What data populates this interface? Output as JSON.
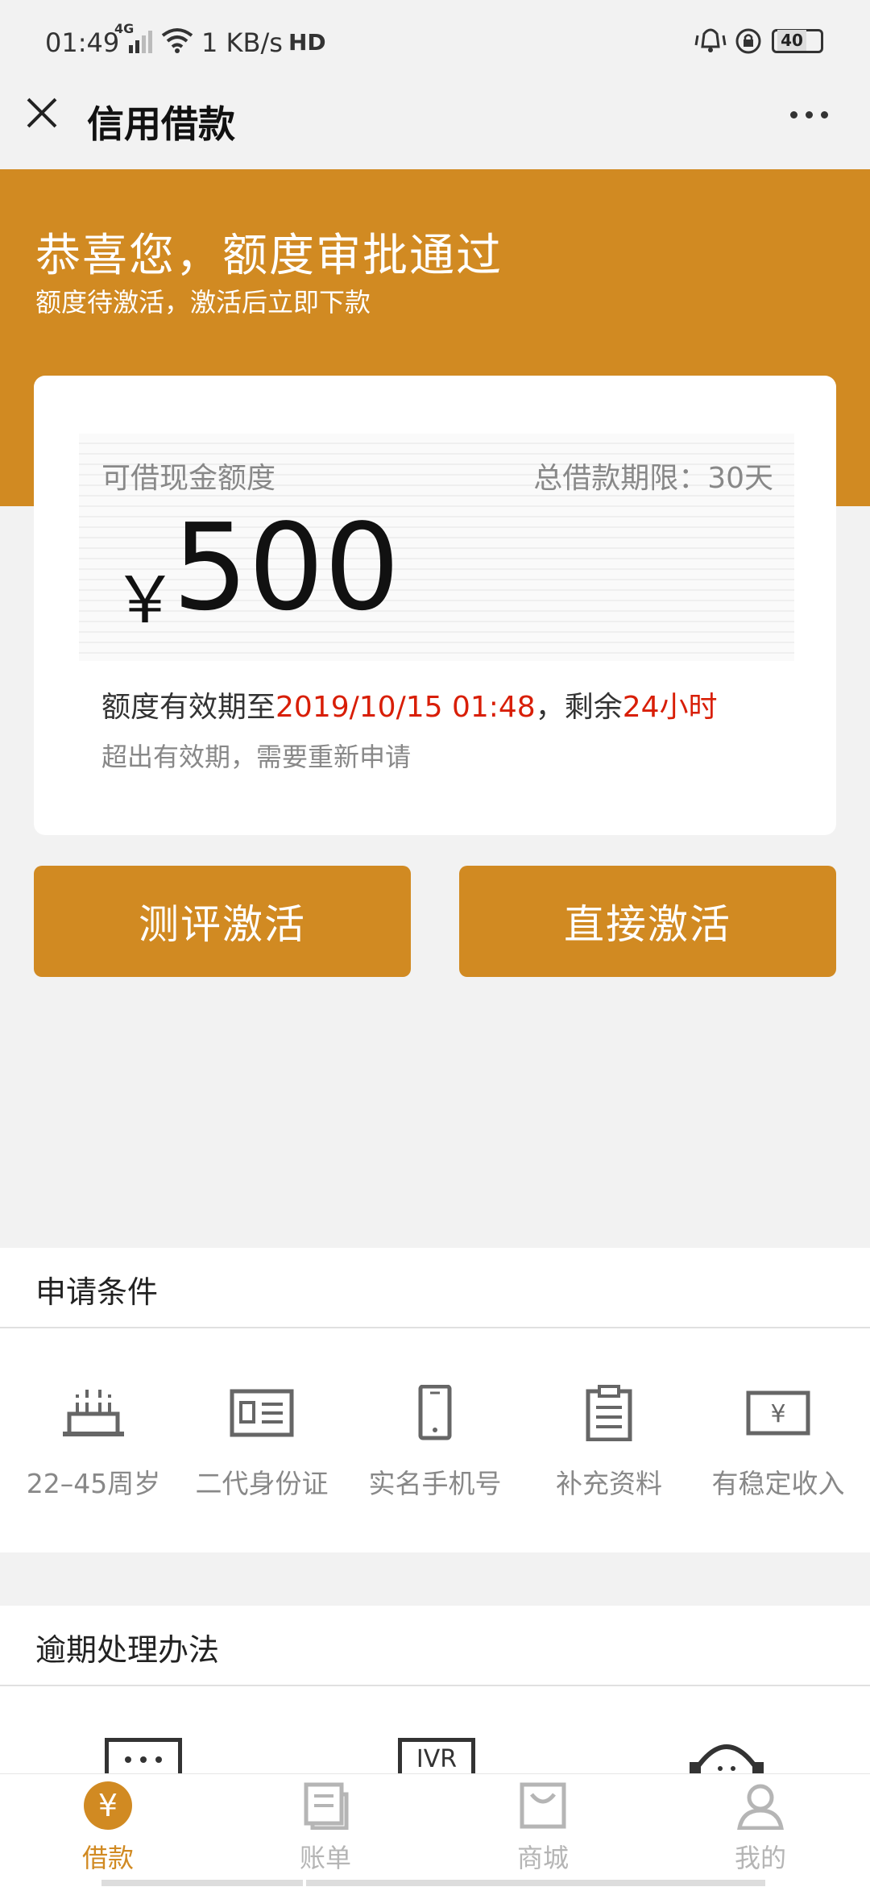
{
  "status_bar": {
    "time": "01:49",
    "network": "4G",
    "speed": "1 KB/s",
    "hd": "HD",
    "battery": "40"
  },
  "header": {
    "title": "信用借款",
    "close_icon": "close-icon",
    "more_icon": "more-icon"
  },
  "banner": {
    "title": "恭喜您，额度审批通过",
    "subtitle": "额度待激活，激活后立即下款"
  },
  "card": {
    "amount_label": "可借现金额度",
    "term_label": "总借款期限：30天",
    "currency": "￥",
    "amount": "500",
    "valid_prefix": "额度有效期至",
    "valid_date": "2019/10/15 01:48",
    "valid_mid": "，剩余",
    "valid_remaining": "24小时",
    "expire_note": "超出有效期，需要重新申请"
  },
  "buttons": {
    "evaluate": "测评激活",
    "direct": "直接激活"
  },
  "conditions": {
    "title": "申请条件",
    "items": [
      {
        "label": "22–45周岁",
        "icon": "cake-icon"
      },
      {
        "label": "二代身份证",
        "icon": "id-card-icon"
      },
      {
        "label": "实名手机号",
        "icon": "phone-icon"
      },
      {
        "label": "补充资料",
        "icon": "clipboard-icon"
      },
      {
        "label": "有稳定收入",
        "icon": "yen-bill-icon"
      }
    ]
  },
  "overdue": {
    "title": "逾期处理办法",
    "icons": [
      "message-icon",
      "ivr-icon",
      "headset-icon"
    ],
    "ivr_text": "IVR"
  },
  "bottom_nav": {
    "items": [
      {
        "label": "借款",
        "icon": "yen-icon",
        "active": true
      },
      {
        "label": "账单",
        "icon": "bill-icon",
        "active": false
      },
      {
        "label": "商城",
        "icon": "shop-bag-icon",
        "active": false
      },
      {
        "label": "我的",
        "icon": "user-icon",
        "active": false
      }
    ]
  },
  "colors": {
    "accent": "#d18a22",
    "highlight": "#d81e06",
    "inactive": "#b5b5b5"
  }
}
